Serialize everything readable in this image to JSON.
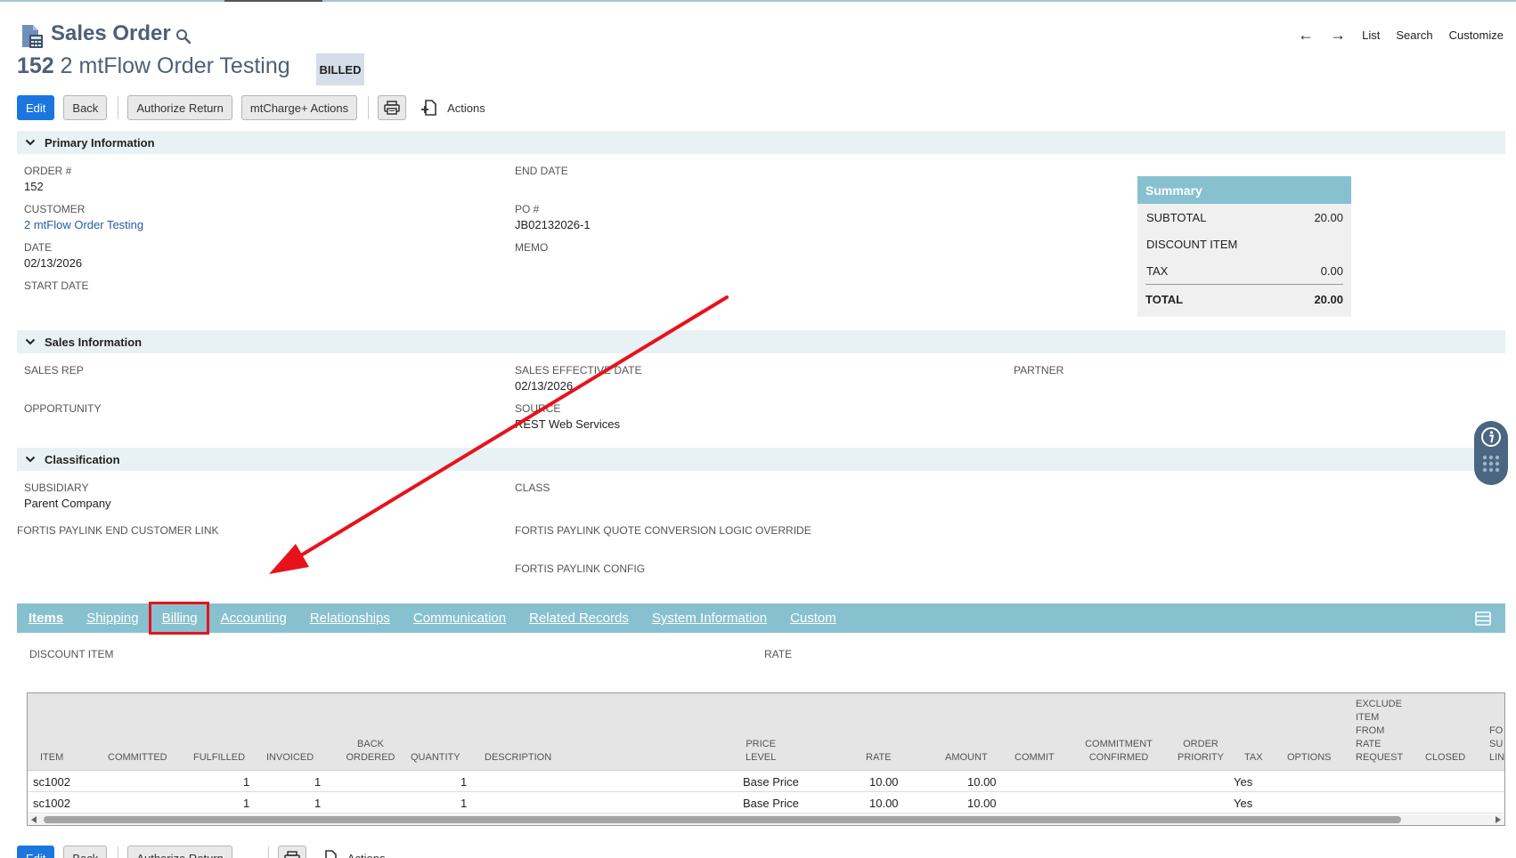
{
  "header": {
    "page_title": "Sales Order",
    "record_number": "152",
    "record_name": "2 mtFlow Order Testing",
    "status_badge": "BILLED"
  },
  "nav": {
    "list": "List",
    "search": "Search",
    "customize": "Customize"
  },
  "toolbar": {
    "edit": "Edit",
    "back": "Back",
    "authorize_return": "Authorize Return",
    "mtcharge_actions": "mtCharge+ Actions",
    "actions": "Actions"
  },
  "sections": {
    "primary": "Primary Information",
    "sales": "Sales Information",
    "classification": "Classification"
  },
  "primary": {
    "order_label": "ORDER #",
    "order_value": "152",
    "customer_label": "CUSTOMER",
    "customer_value": "2 mtFlow Order Testing",
    "date_label": "DATE",
    "date_value": "02/13/2026",
    "start_date_label": "START DATE",
    "end_date_label": "END DATE",
    "po_label": "PO #",
    "po_value": "JB02132026-1",
    "memo_label": "MEMO"
  },
  "summary": {
    "title": "Summary",
    "subtotal_label": "SUBTOTAL",
    "subtotal_value": "20.00",
    "discount_label": "DISCOUNT ITEM",
    "tax_label": "TAX",
    "tax_value": "0.00",
    "total_label": "TOTAL",
    "total_value": "20.00"
  },
  "sales": {
    "sales_rep_label": "SALES REP",
    "opportunity_label": "OPPORTUNITY",
    "effective_date_label": "SALES EFFECTIVE DATE",
    "effective_date_value": "02/13/2026",
    "source_label": "SOURCE",
    "source_value": "REST Web Services",
    "partner_label": "PARTNER"
  },
  "classification": {
    "subsidiary_label": "SUBSIDIARY",
    "subsidiary_value": "Parent Company",
    "class_label": "CLASS",
    "paylink_customer_label": "FORTIS PAYLINK END CUSTOMER LINK",
    "paylink_quote_label": "FORTIS PAYLINK QUOTE CONVERSION LOGIC OVERRIDE",
    "paylink_config_label": "FORTIS PAYLINK CONFIG"
  },
  "tabs": [
    {
      "label": "Items"
    },
    {
      "label": "Shipping"
    },
    {
      "label": "Billing"
    },
    {
      "label": "Accounting"
    },
    {
      "label": "Relationships"
    },
    {
      "label": "Communication"
    },
    {
      "label": "Related Records"
    },
    {
      "label": "System Information"
    },
    {
      "label": "Custom"
    }
  ],
  "items": {
    "discount_item_label": "DISCOUNT ITEM",
    "rate_label": "RATE",
    "columns": {
      "item": "ITEM",
      "committed": "COMMITTED",
      "fulfilled": "FULFILLED",
      "invoiced": "INVOICED",
      "back_ordered_1": "BACK",
      "back_ordered_2": "ORDERED",
      "quantity": "QUANTITY",
      "description": "DESCRIPTION",
      "price_level_1": "PRICE",
      "price_level_2": "LEVEL",
      "rate": "RATE",
      "amount": "AMOUNT",
      "commit": "COMMIT",
      "commitment_confirmed_1": "COMMITMENT",
      "commitment_confirmed_2": "CONFIRMED",
      "order_priority_1": "ORDER",
      "order_priority_2": "PRIORITY",
      "tax": "TAX",
      "options": "OPTIONS",
      "exclude_1": "EXCLUDE",
      "exclude_2": "ITEM",
      "exclude_3": "FROM",
      "exclude_4": "RATE",
      "exclude_5": "REQUEST",
      "closed": "CLOSED",
      "fo_1": "FO",
      "fo_2": "SU",
      "fo_3": "LIN"
    },
    "rows": [
      {
        "item": "sc1002",
        "fulfilled": "1",
        "invoiced": "1",
        "quantity": "1",
        "price_level": "Base Price",
        "rate": "10.00",
        "amount": "10.00",
        "tax": "Yes"
      },
      {
        "item": "sc1002",
        "fulfilled": "1",
        "invoiced": "1",
        "quantity": "1",
        "price_level": "Base Price",
        "rate": "10.00",
        "amount": "10.00",
        "tax": "Yes"
      }
    ]
  },
  "colors": {
    "accent": "#87c1cf",
    "primary_button": "#1b76e0",
    "annotation_red": "#e8121b",
    "title_text": "#4d5f79"
  }
}
